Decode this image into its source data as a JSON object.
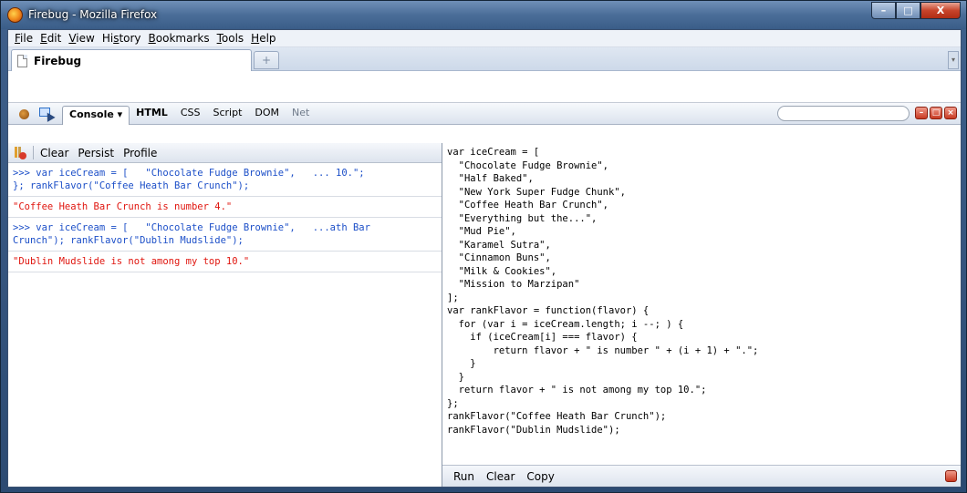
{
  "window": {
    "title": "Firebug - Mozilla Firefox",
    "min": "–",
    "max": "□",
    "close": "X"
  },
  "menu": [
    {
      "key": "F",
      "rest": "ile"
    },
    {
      "key": "E",
      "rest": "dit"
    },
    {
      "key": "V",
      "rest": "iew"
    },
    {
      "pre": "Hi",
      "key": "s",
      "rest": "tory"
    },
    {
      "key": "B",
      "rest": "ookmarks"
    },
    {
      "key": "T",
      "rest": "ools"
    },
    {
      "key": "H",
      "rest": "elp"
    }
  ],
  "tabs": {
    "active_label": "Firebug",
    "new_tab": "+"
  },
  "firebug": {
    "panels": {
      "console": "Console ▾",
      "html": "HTML",
      "css": "CSS",
      "script": "Script",
      "dom": "DOM",
      "net": "Net"
    },
    "search_placeholder": "",
    "console_toolbar": {
      "clear": "Clear",
      "persist": "Persist",
      "profile": "Profile"
    },
    "log": [
      {
        "kind": "cmd",
        "text": ">>> var iceCream = [   \"Chocolate Fudge Brownie\",   ... 10.\";\n}; rankFlavor(\"Coffee Heath Bar Crunch\");"
      },
      {
        "kind": "result",
        "text": "\"Coffee Heath Bar Crunch is number 4.\""
      },
      {
        "kind": "cmd",
        "text": ">>> var iceCream = [   \"Chocolate Fudge Brownie\",   ...ath Bar\nCrunch\"); rankFlavor(\"Dublin Mudslide\");"
      },
      {
        "kind": "result",
        "text": "\"Dublin Mudslide is not among my top 10.\""
      }
    ],
    "editor_code": "var iceCream = [\n  \"Chocolate Fudge Brownie\",\n  \"Half Baked\",\n  \"New York Super Fudge Chunk\",\n  \"Coffee Heath Bar Crunch\",\n  \"Everything but the...\",\n  \"Mud Pie\",\n  \"Karamel Sutra\",\n  \"Cinnamon Buns\",\n  \"Milk & Cookies\",\n  \"Mission to Marzipan\"\n];\nvar rankFlavor = function(flavor) {\n  for (var i = iceCream.length; i --; ) {\n    if (iceCream[i] === flavor) {\n        return flavor + \" is number \" + (i + 1) + \".\";\n    }\n  }\n  return flavor + \" is not among my top 10.\";\n};\nrankFlavor(\"Coffee Heath Bar Crunch\");\nrankFlavor(\"Dublin Mudslide\");",
    "editor_toolbar": {
      "run": "Run",
      "clear": "Clear",
      "copy": "Copy"
    }
  }
}
